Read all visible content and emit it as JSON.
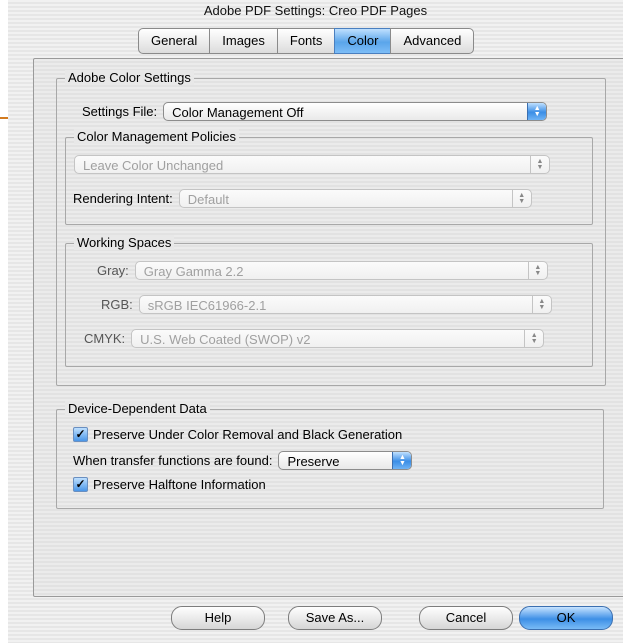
{
  "window": {
    "title": "Adobe PDF Settings: Creo PDF Pages"
  },
  "tabs": [
    {
      "label": "General",
      "active": false
    },
    {
      "label": "Images",
      "active": false
    },
    {
      "label": "Fonts",
      "active": false
    },
    {
      "label": "Color",
      "active": true
    },
    {
      "label": "Advanced",
      "active": false
    }
  ],
  "color_settings": {
    "group_title": "Adobe Color Settings",
    "settings_file_label": "Settings File:",
    "settings_file_value": "Color Management Off",
    "policies": {
      "group_title": "Color Management Policies",
      "policy_value": "Leave Color Unchanged",
      "rendering_intent_label": "Rendering Intent:",
      "rendering_intent_value": "Default"
    },
    "working_spaces": {
      "group_title": "Working Spaces",
      "gray_label": "Gray:",
      "gray_value": "Gray Gamma 2.2",
      "rgb_label": "RGB:",
      "rgb_value": "sRGB IEC61966-2.1",
      "cmyk_label": "CMYK:",
      "cmyk_value": "U.S. Web Coated (SWOP) v2"
    }
  },
  "device_data": {
    "group_title": "Device-Dependent Data",
    "ucr_label": "Preserve Under Color Removal and Black Generation",
    "ucr_checked": true,
    "transfer_label": "When transfer functions are found:",
    "transfer_value": "Preserve",
    "halftone_label": "Preserve Halftone Information",
    "halftone_checked": true
  },
  "buttons": {
    "help": "Help",
    "save_as": "Save As...",
    "cancel": "Cancel",
    "ok": "OK"
  },
  "colors": {
    "accent": "#3d8fe6",
    "callout": "#d27a1f"
  }
}
